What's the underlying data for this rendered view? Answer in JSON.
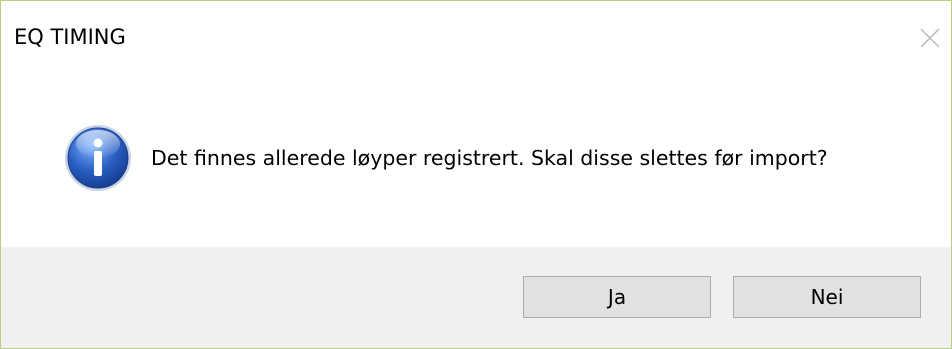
{
  "dialog": {
    "title": "EQ TIMING",
    "message": "Det finnes allerede løyper registrert. Skal disse slettes før import?",
    "icon": "information-icon",
    "buttons": {
      "yes_label": "Ja",
      "no_label": "Nei"
    }
  },
  "colors": {
    "window_border": "#b9d07a",
    "footer_background": "#f0f0f0",
    "button_background": "#e1e1e1",
    "icon_blue": "#2a5fc4"
  }
}
